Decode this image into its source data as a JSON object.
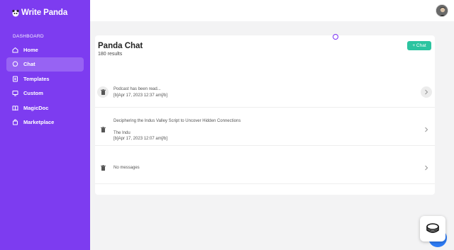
{
  "app": {
    "name": "Write Panda"
  },
  "sidebar": {
    "section_label": "DASHBOARD",
    "items": [
      {
        "label": "Home",
        "icon": "home-icon",
        "active": false
      },
      {
        "label": "Chat",
        "icon": "chat-bubble-icon",
        "active": true
      },
      {
        "label": "Templates",
        "icon": "templates-icon",
        "active": false
      },
      {
        "label": "Custom",
        "icon": "monitor-icon",
        "active": false
      },
      {
        "label": "MagicDoc",
        "icon": "book-icon",
        "active": false
      },
      {
        "label": "Marketplace",
        "icon": "store-icon",
        "active": false
      }
    ]
  },
  "header": {
    "avatar": "user-avatar"
  },
  "main": {
    "title": "Panda Chat",
    "results": "180 results",
    "new_chat_label": "+ Chat",
    "chats": [
      {
        "title": "Podcast has been read...",
        "subtitle": "",
        "date": "[b]Apr 17, 2023 12:37 am[/b]"
      },
      {
        "title": "Deciphering the Indus Valley Script to Uncover Hidden Connections",
        "subtitle": "The Indu",
        "date": "[b]Apr 17, 2023 12:07 am[/b]"
      },
      {
        "title": "No messages",
        "subtitle": "",
        "date": ""
      }
    ]
  },
  "colors": {
    "sidebar": "#7d3cf0",
    "accent": "#2cc4a0",
    "loader": "#7b2ff7",
    "help_bubble": "#2d7bf4"
  }
}
